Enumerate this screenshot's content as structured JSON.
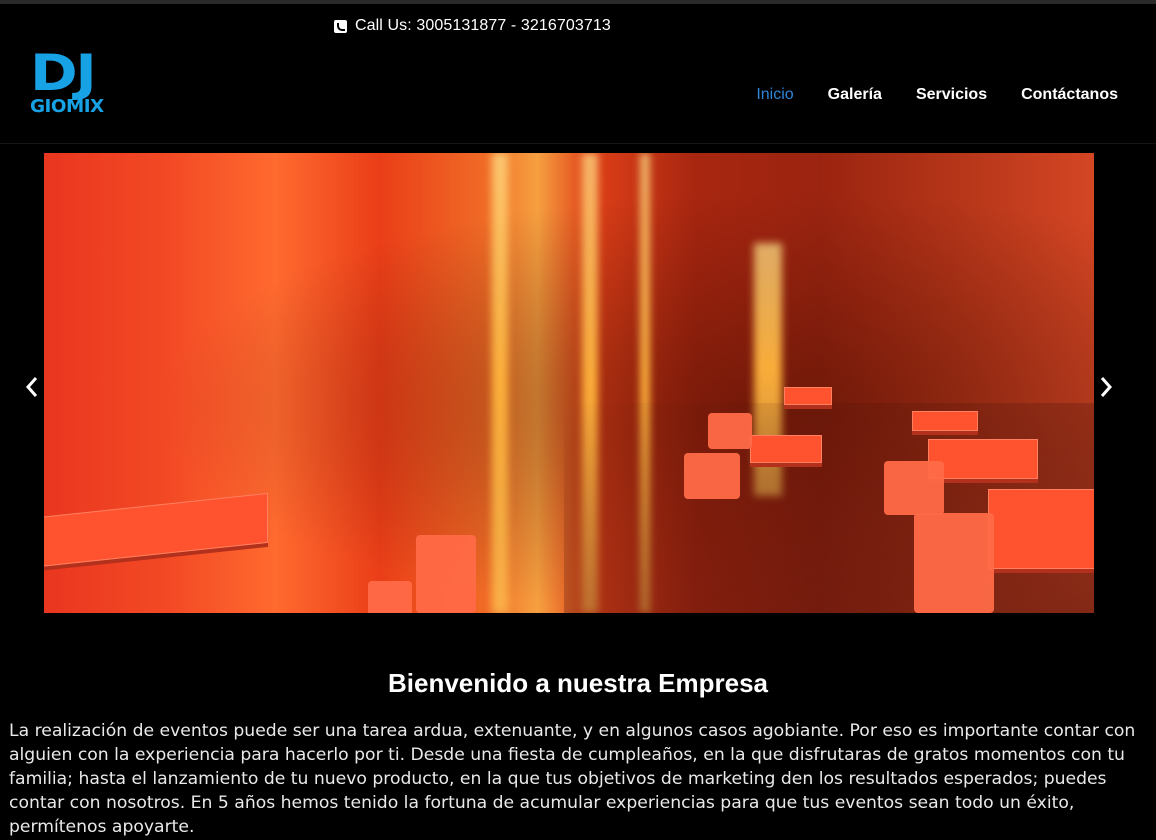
{
  "header": {
    "call_label": "Call Us: 3005131877 - 3216703713",
    "logo_top": "DJ",
    "logo_bottom": "GIOMIX",
    "nav": [
      {
        "label": "Inicio",
        "active": true
      },
      {
        "label": "Galería",
        "active": false
      },
      {
        "label": "Servicios",
        "active": false
      },
      {
        "label": "Contáctanos",
        "active": false
      }
    ]
  },
  "slider": {
    "image": "red-lit-event-hall-icon",
    "prev_icon": "chevron-left-icon",
    "next_icon": "chevron-right-icon"
  },
  "content": {
    "title": "Bienvenido a nuestra Empresa",
    "paragraph": "La realización de eventos puede ser una tarea ardua, extenuante, y en algunos casos agobiante. Por eso es importante contar con alguien con la experiencia para hacerlo por ti. Desde una fiesta de cumpleaños, en la que disfrutaras de gratos momentos con tu familia; hasta el lanzamiento de tu nuevo producto, en la que tus objetivos de marketing den los resultados esperados; puedes contar con nosotros. En 5 años hemos tenido la fortuna de acumular experiencias para que tus eventos sean todo un éxito, permítenos apoyarte."
  },
  "colors": {
    "accent": "#2f86d6",
    "logo": "#18a2e6",
    "background": "#000000"
  }
}
